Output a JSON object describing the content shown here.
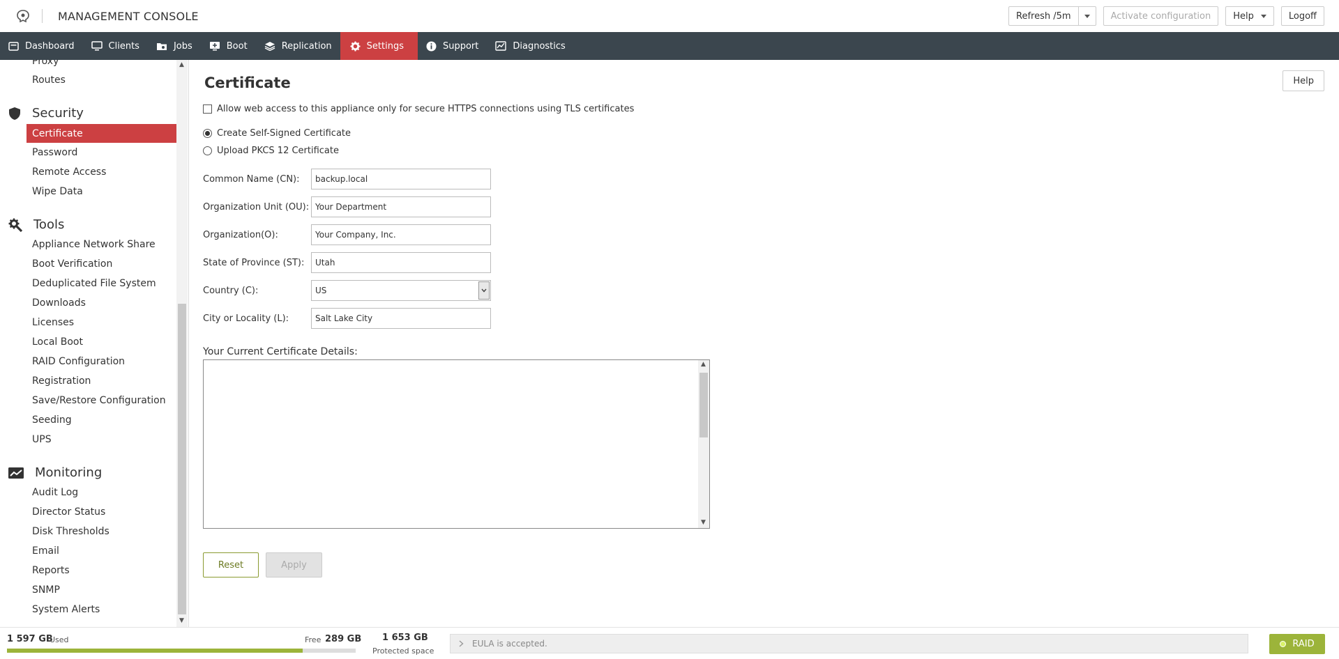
{
  "header": {
    "title": "MANAGEMENT CONSOLE",
    "refresh_label": "Refresh /5m",
    "activate_label": "Activate configuration",
    "help_label": "Help",
    "logoff_label": "Logoff"
  },
  "nav": {
    "items": [
      {
        "label": "Dashboard",
        "icon": "dashboard-icon"
      },
      {
        "label": "Clients",
        "icon": "monitor-icon"
      },
      {
        "label": "Jobs",
        "icon": "jobs-icon"
      },
      {
        "label": "Boot",
        "icon": "boot-icon"
      },
      {
        "label": "Replication",
        "icon": "layers-icon"
      },
      {
        "label": "Settings",
        "icon": "gear-icon",
        "active": true
      },
      {
        "label": "Support",
        "icon": "info-icon"
      },
      {
        "label": "Diagnostics",
        "icon": "chart-icon"
      }
    ]
  },
  "sidebar": {
    "network_items": [
      "Proxy",
      "Routes"
    ],
    "security": {
      "title": "Security",
      "items": [
        "Certificate",
        "Password",
        "Remote Access",
        "Wipe Data"
      ]
    },
    "tools": {
      "title": "Tools",
      "items": [
        "Appliance Network Share",
        "Boot Verification",
        "Deduplicated File System",
        "Downloads",
        "Licenses",
        "Local Boot",
        "RAID Configuration",
        "Registration",
        "Save/Restore Configuration",
        "Seeding",
        "UPS"
      ]
    },
    "monitoring": {
      "title": "Monitoring",
      "items": [
        "Audit Log",
        "Director Status",
        "Disk Thresholds",
        "Email",
        "Reports",
        "SNMP",
        "System Alerts"
      ]
    }
  },
  "main": {
    "title": "Certificate",
    "help_label": "Help",
    "https_check_label": "Allow web access to this appliance only for secure HTTPS connections using TLS certificates",
    "radio_self_signed": "Create Self-Signed Certificate",
    "radio_upload": "Upload PKCS 12 Certificate",
    "fields": {
      "cn": {
        "label": "Common Name (CN):",
        "value": "backup.local"
      },
      "ou": {
        "label": "Organization Unit (OU):",
        "value": "Your Department"
      },
      "o": {
        "label": "Organization(O):",
        "value": "Your Company, Inc."
      },
      "st": {
        "label": "State of Province (ST):",
        "value": "Utah"
      },
      "c": {
        "label": "Country (C):",
        "value": "US"
      },
      "l": {
        "label": "City or Locality (L):",
        "value": "Salt Lake City"
      }
    },
    "details_label": "Your Current Certificate Details:",
    "reset_label": "Reset",
    "apply_label": "Apply"
  },
  "footer": {
    "used_value": "1 597 GB",
    "used_label": "Used",
    "free_label": "Free",
    "free_value": "289 GB",
    "used_fraction": 0.847,
    "protected_value": "1 653 GB",
    "protected_label": "Protected space",
    "eula_text": "EULA is accepted.",
    "raid_label": "RAID"
  },
  "colors": {
    "nav_bg": "#3b464e",
    "accent_red": "#cc4042",
    "accent_green": "#9cb43a"
  }
}
